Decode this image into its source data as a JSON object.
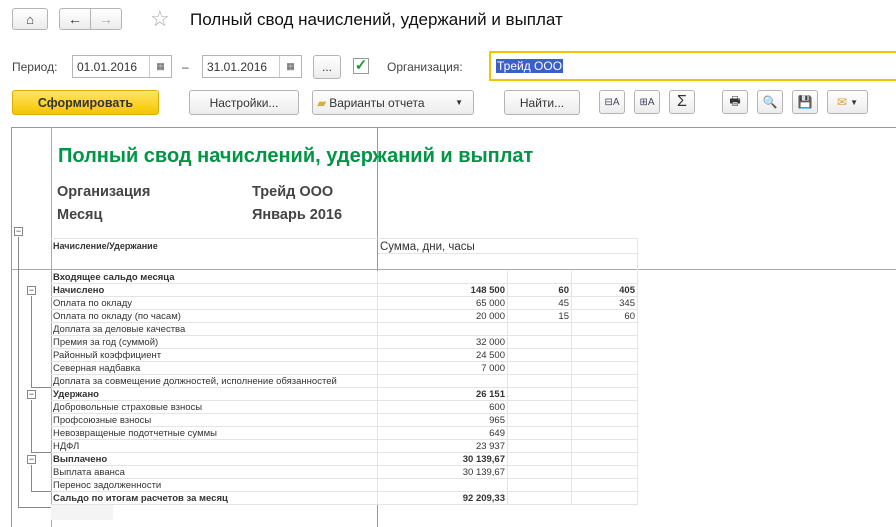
{
  "header": {
    "title": "Полный свод начислений, удержаний и выплат"
  },
  "form": {
    "period_label": "Период:",
    "date_from": "01.01.2016",
    "dash": "–",
    "date_to": "31.01.2016",
    "more": "...",
    "org_label": "Организация:",
    "org_value": "Трейд ООО"
  },
  "toolbar": {
    "generate": "Сформировать",
    "settings": "Настройки...",
    "variants": "Варианты отчета",
    "find": "Найти..."
  },
  "report": {
    "title": "Полный свод начислений, удержаний и выплат",
    "org_label": "Организация",
    "org_value": "Трейд ООО",
    "month_label": "Месяц",
    "month_value": "Январь 2016",
    "col_name": "Начисление/Удержание",
    "col_values": "Сумма, дни, часы",
    "rows": [
      {
        "name": "Входящее сальдо месяца",
        "sum": "",
        "days": "",
        "hours": "",
        "bold": true
      },
      {
        "name": "Начислено",
        "sum": "148 500",
        "days": "60",
        "hours": "405",
        "bold": true
      },
      {
        "name": "Оплата по окладу",
        "sum": "65 000",
        "days": "45",
        "hours": "345"
      },
      {
        "name": "Оплата по окладу (по часам)",
        "sum": "20 000",
        "days": "15",
        "hours": "60"
      },
      {
        "name": "Доплата за деловые качества",
        "sum": "",
        "days": "",
        "hours": ""
      },
      {
        "name": "Премия за год (суммой)",
        "sum": "32 000",
        "days": "",
        "hours": ""
      },
      {
        "name": "Районный коэффициент",
        "sum": "24 500",
        "days": "",
        "hours": ""
      },
      {
        "name": "Северная надбавка",
        "sum": "7 000",
        "days": "",
        "hours": ""
      },
      {
        "name": "Доплата за совмещение должностей, исполнение обязанностей",
        "sum": "",
        "days": "",
        "hours": ""
      },
      {
        "name": "Удержано",
        "sum": "26 151",
        "days": "",
        "hours": "",
        "bold": true
      },
      {
        "name": "Добровольные страховые взносы",
        "sum": "600",
        "days": "",
        "hours": ""
      },
      {
        "name": "Профсоюзные взносы",
        "sum": "965",
        "days": "",
        "hours": ""
      },
      {
        "name": "Невозвращеные подотчетные суммы",
        "sum": "649",
        "days": "",
        "hours": ""
      },
      {
        "name": "НДФЛ",
        "sum": "23 937",
        "days": "",
        "hours": ""
      },
      {
        "name": "Выплачено",
        "sum": "30 139,67",
        "days": "",
        "hours": "",
        "bold": true
      },
      {
        "name": "Выплата аванса",
        "sum": "30 139,67",
        "days": "",
        "hours": ""
      },
      {
        "name": "Перенос задолженности",
        "sum": "",
        "days": "",
        "hours": ""
      },
      {
        "name": "Сальдо по итогам расчетов за месяц",
        "sum": "92 209,33",
        "days": "",
        "hours": "",
        "bold": true
      }
    ]
  },
  "colors": {
    "accent": "#f5c400",
    "title_green": "#009646",
    "selection": "#3a5fcd"
  }
}
